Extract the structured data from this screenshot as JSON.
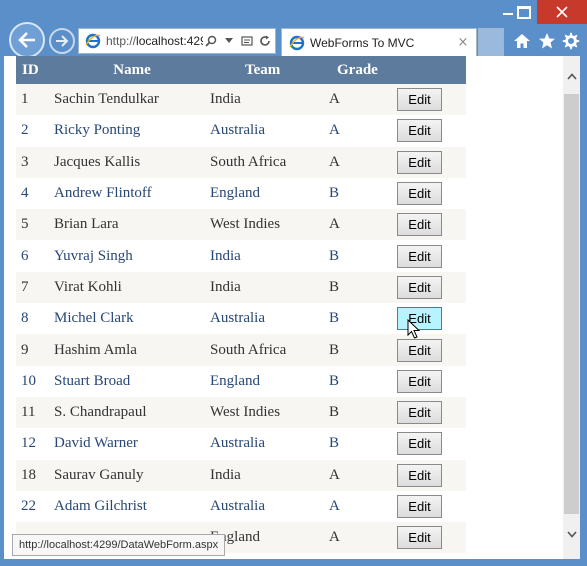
{
  "browser": {
    "address": {
      "url_prefix": "http://",
      "url_host": "localhost:429"
    },
    "tab": {
      "title": "WebForms To MVC",
      "close_glyph": "×"
    },
    "status_url": "http://localhost:4299/DataWebForm.aspx"
  },
  "icons": {
    "back": "back-arrow-icon",
    "forward": "forward-arrow-icon",
    "search": "search-icon",
    "compat": "compatibility-view-icon",
    "refresh": "refresh-icon",
    "home": "home-icon",
    "favorites": "star-icon",
    "tools": "gear-icon"
  },
  "colors": {
    "frame": "#5b8fc9",
    "grid_header": "#5d7b9d",
    "row_alt_text": "#284775",
    "hover_button": "#b8f4ff"
  },
  "grid": {
    "headers": {
      "id": "ID",
      "name": "Name",
      "team": "Team",
      "grade": "Grade"
    },
    "edit_label": "Edit",
    "rows": [
      {
        "id": "1",
        "name": "Sachin Tendulkar",
        "team": "India",
        "grade": "A"
      },
      {
        "id": "2",
        "name": "Ricky Ponting",
        "team": "Australia",
        "grade": "A"
      },
      {
        "id": "3",
        "name": "Jacques Kallis",
        "team": "South Africa",
        "grade": "A"
      },
      {
        "id": "4",
        "name": "Andrew Flintoff",
        "team": "England",
        "grade": "B"
      },
      {
        "id": "5",
        "name": "Brian Lara",
        "team": "West Indies",
        "grade": "A"
      },
      {
        "id": "6",
        "name": "Yuvraj Singh",
        "team": "India",
        "grade": "B"
      },
      {
        "id": "7",
        "name": "Virat Kohli",
        "team": "India",
        "grade": "B"
      },
      {
        "id": "8",
        "name": "Michel Clark",
        "team": "Australia",
        "grade": "B"
      },
      {
        "id": "9",
        "name": "Hashim Amla",
        "team": "South Africa",
        "grade": "B"
      },
      {
        "id": "10",
        "name": "Stuart Broad",
        "team": "England",
        "grade": "B"
      },
      {
        "id": "11",
        "name": "S. Chandrapaul",
        "team": "West Indies",
        "grade": "B"
      },
      {
        "id": "12",
        "name": "David Warner",
        "team": "Australia",
        "grade": "B"
      },
      {
        "id": "18",
        "name": "Saurav Ganuly",
        "team": "India",
        "grade": "A"
      },
      {
        "id": "22",
        "name": "Adam Gilchrist",
        "team": "Australia",
        "grade": "A"
      },
      {
        "id": "",
        "name": "",
        "team": "England",
        "grade": "A"
      }
    ]
  }
}
